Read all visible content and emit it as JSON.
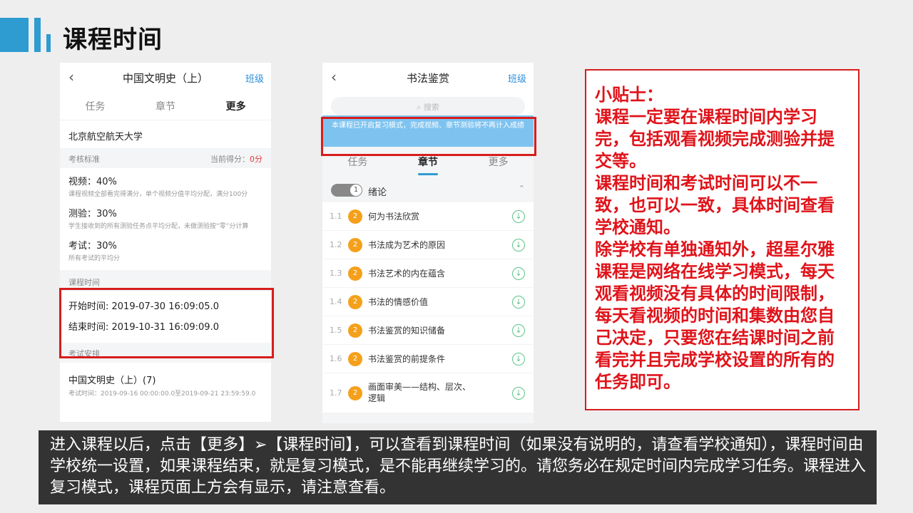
{
  "slide": {
    "title": "课程时间"
  },
  "phone1": {
    "back_icon": "chevron-left-icon",
    "nav_title": "中国文明史（上）",
    "nav_right": "班级",
    "tabs": [
      "任务",
      "章节",
      "更多"
    ],
    "university": "北京航空航天大学",
    "criteria_label": "考核标准",
    "score_label": "当前得分：",
    "score_value": "0分",
    "items": [
      {
        "title": "视频：40%",
        "desc": "课程视频全部看完得满分，单个视频分值平均分配，满分100分"
      },
      {
        "title": "测验：30%",
        "desc": "学生接收到的所有测验任务点平均分配，未做测验按“零”分计算"
      },
      {
        "title": "考试：30%",
        "desc": "所有考试的平均分"
      }
    ],
    "course_time_label": "课程时间",
    "start_time": "开始时间: 2019-07-30 16:09:05.0",
    "end_time": "结束时间: 2019-10-31 16:09:09.0",
    "exam_label": "考试安排",
    "exam_title": "中国文明史（上）(7)",
    "exam_desc": "考试时间：2019-09-16 00:00:00.0至2019-09-21 23:59:59.0"
  },
  "phone2": {
    "back_icon": "chevron-left-icon",
    "nav_title": "书法鉴赏",
    "nav_right": "班级",
    "search_placeholder": "搜索",
    "review_banner": "本课程已开启复习模式，完成视频、章节测验将不再计入成绩",
    "tabs": [
      "任务",
      "章节",
      "更多"
    ],
    "chapter": {
      "num": "1",
      "title": "绪论"
    },
    "lessons": [
      {
        "num": "1.1",
        "badge": "2",
        "title": "何为书法欣赏"
      },
      {
        "num": "1.2",
        "badge": "2",
        "title": "书法成为艺术的原因"
      },
      {
        "num": "1.3",
        "badge": "2",
        "title": "书法艺术的内在蕴含"
      },
      {
        "num": "1.4",
        "badge": "2",
        "title": "书法的情感价值"
      },
      {
        "num": "1.5",
        "badge": "2",
        "title": "书法鉴赏的知识储备"
      },
      {
        "num": "1.6",
        "badge": "2",
        "title": "书法鉴赏的前提条件"
      },
      {
        "num": "1.7",
        "badge": "2",
        "title": "画面审美——结构、层次、逻辑"
      }
    ]
  },
  "tip": {
    "lines": [
      "小贴士：",
      "课程一定要在课程时间内学习完，包括观看视频完成测验并提交等。",
      "课程时间和考试时间可以不一致，也可以一致，具体时间查看学校通知。",
      "除学校有单独通知外，超星尔雅课程是网络在线学习模式，每天观看视频没有具体的时间限制，每天看视频的时间和集数由您自己决定，只要您在结课时间之前看完并且完成学校设置的所有的任务即可。"
    ]
  },
  "caption": {
    "text": "进入课程以后，点击【更多】➢【课程时间】，可以查看到课程时间（如果没有说明的，请查看学校通知），课程时间由学校统一设置，如果课程结束，就是复习模式，是不能再继续学习的。请您务必在规定时间内完成学习任务。课程进入复习模式，课程页面上方会有显示，请注意查看。"
  },
  "colors": {
    "accent": "#2e9bd1",
    "highlight_red": "#d71d1d",
    "tip_text": "#e0131a",
    "caption_bg": "#333333"
  }
}
